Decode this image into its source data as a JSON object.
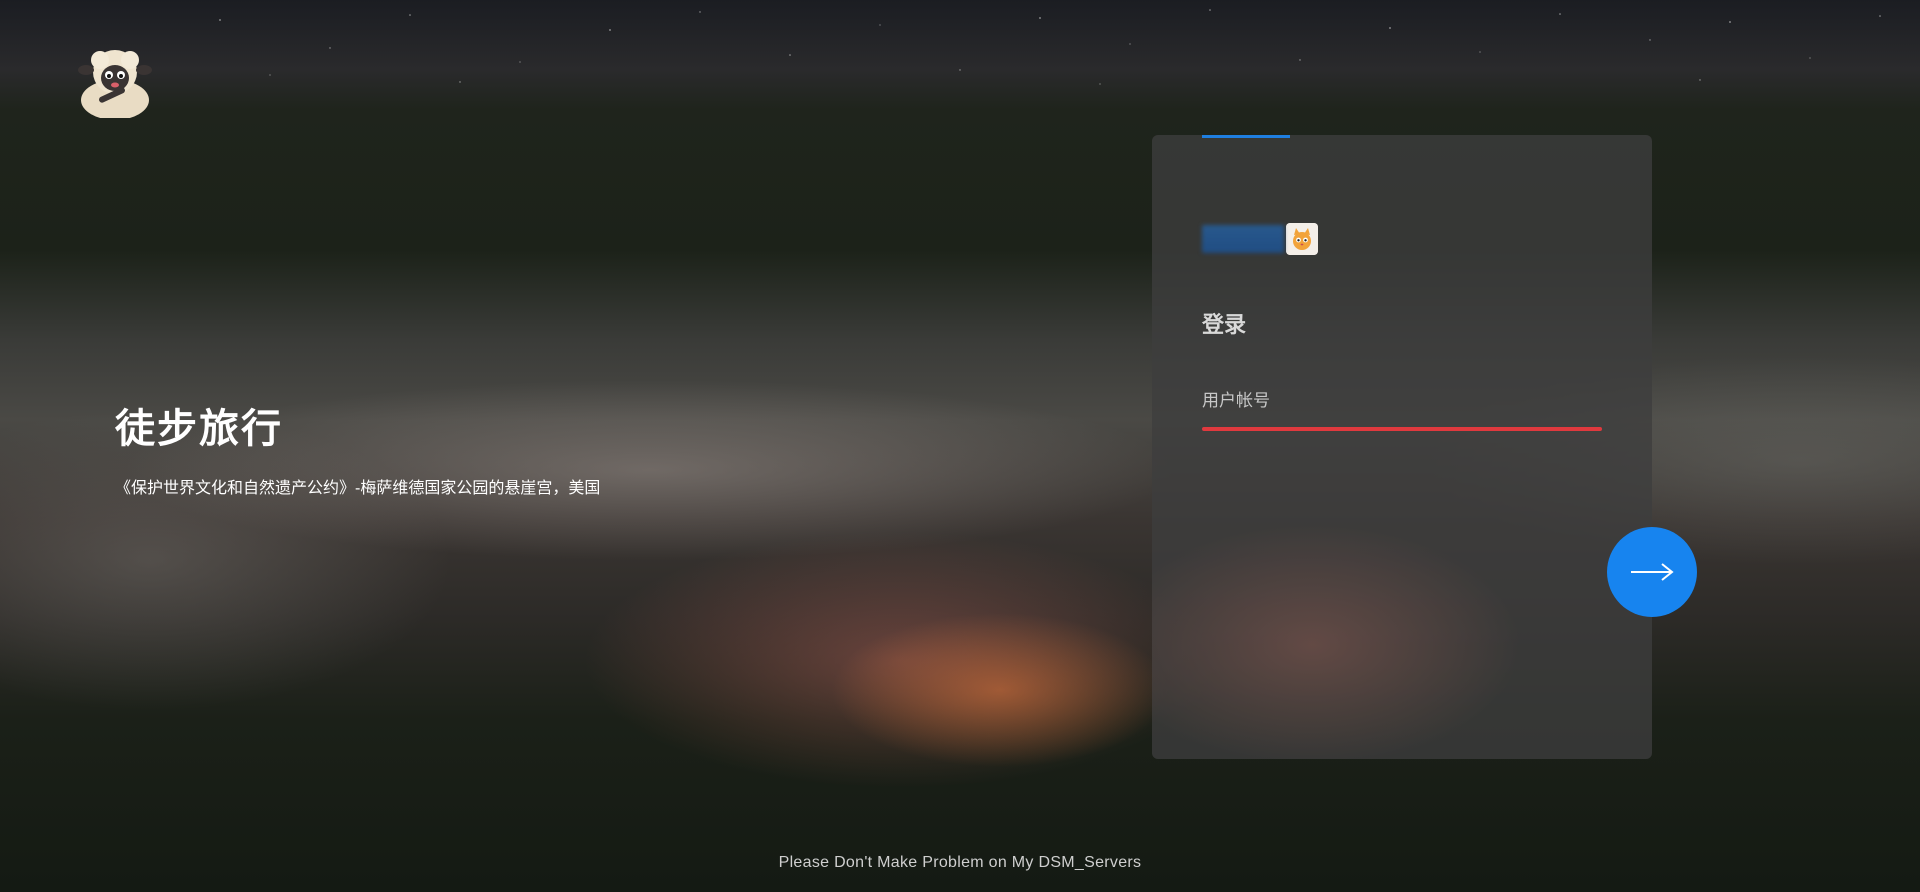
{
  "background": {
    "description_colors": {
      "accent_blue": "#1784ef",
      "error_red": "#e0393e"
    }
  },
  "logo": {
    "icon": "sheep-mascot-icon"
  },
  "hero": {
    "title": "徒步旅行",
    "caption": "《保护世界文化和自然遗产公约》-梅萨维德国家公园的悬崖宫，美国"
  },
  "login": {
    "title": "登录",
    "username_placeholder": "用户帐号",
    "username_value": "",
    "brand_avatar_icon": "cat-avatar-icon",
    "next_icon": "arrow-right-icon"
  },
  "footer": {
    "text": "Please Don't Make Problem on My DSM_Servers"
  }
}
